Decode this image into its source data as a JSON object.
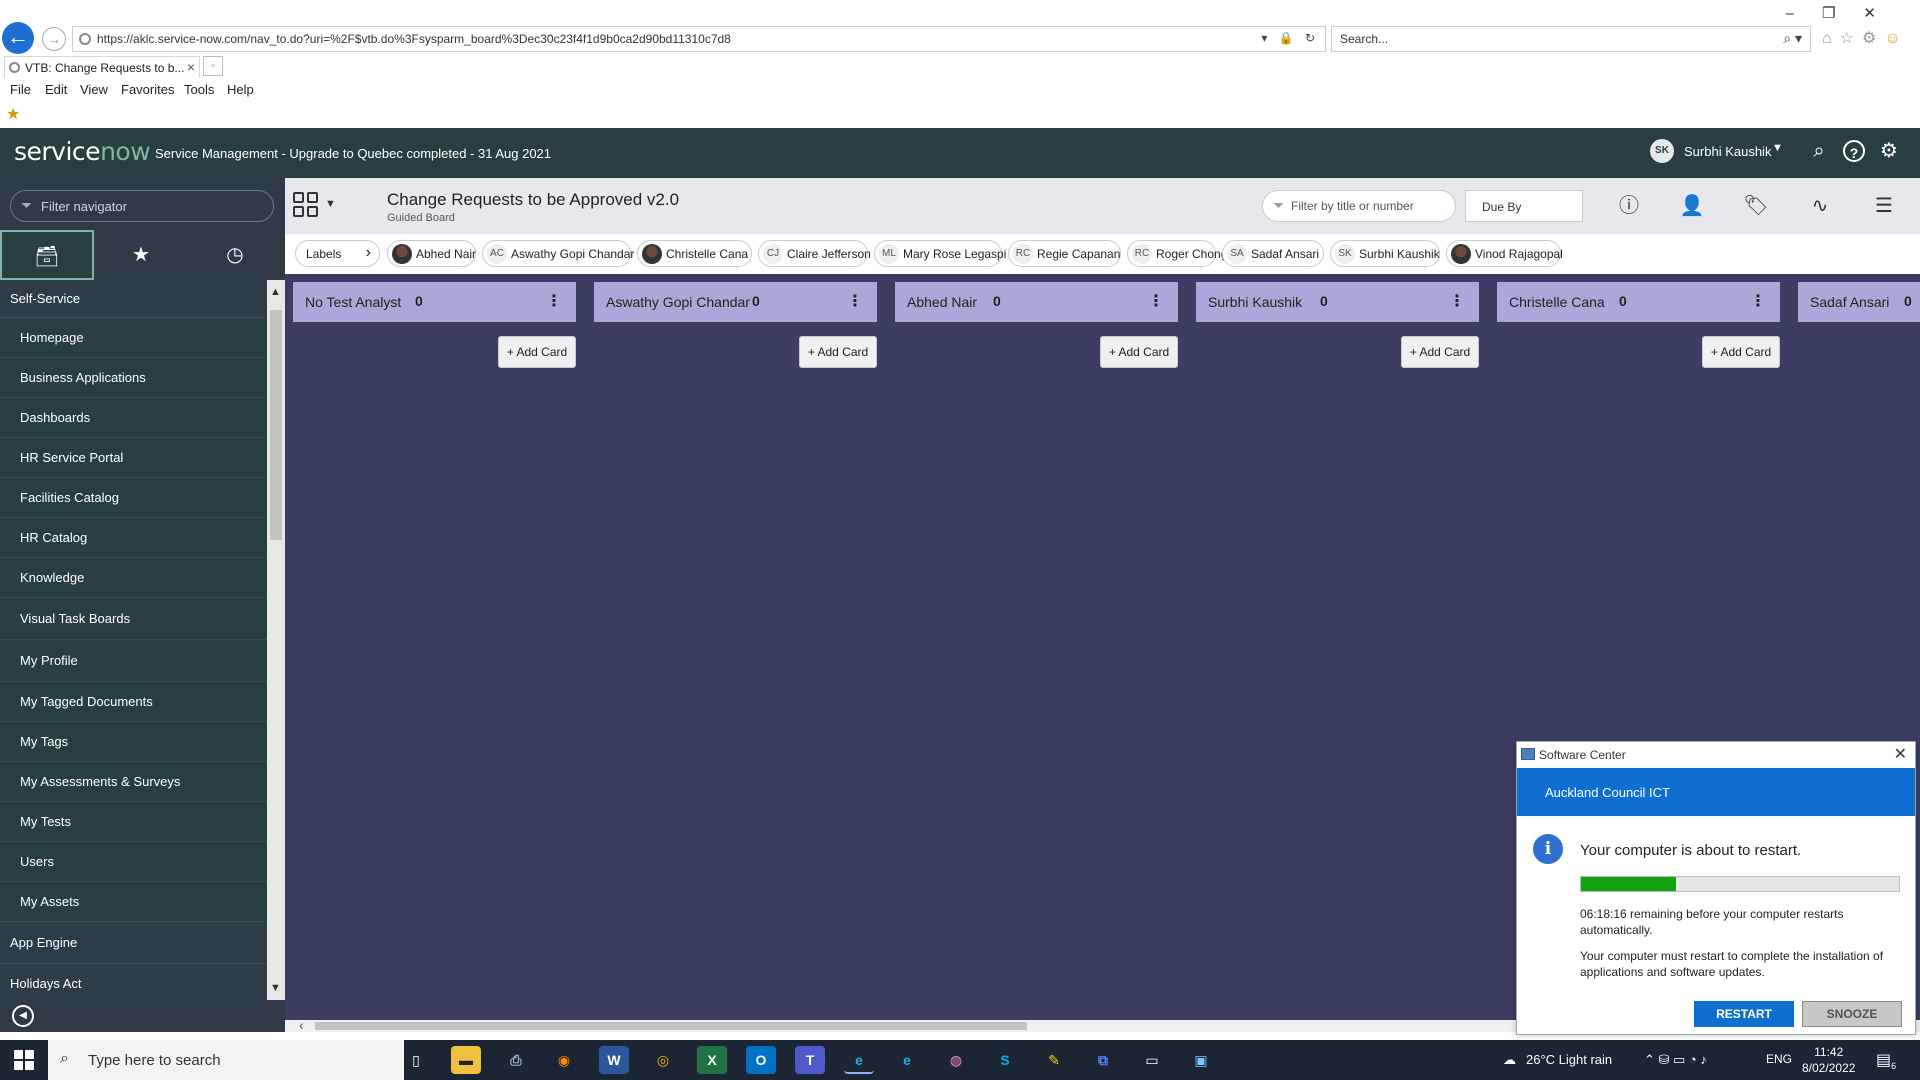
{
  "browser": {
    "url": "https://aklc.service-now.com/nav_to.do?uri=%2F$vtb.do%3Fsysparm_board%3Dec30c23f4f1d9b0ca2d90bd11310c7d8",
    "search_placeholder": "Search...",
    "tab_title": "VTB: Change Requests to b...",
    "menu": [
      "File",
      "Edit",
      "View",
      "Favorites",
      "Tools",
      "Help"
    ]
  },
  "header": {
    "logo_prefix": "service",
    "logo_accent": "now",
    "title": "Service Management - Upgrade to Quebec completed - 31 Aug 2021",
    "user_initials": "SK",
    "user_name": "Surbhi Kaushik"
  },
  "navigator": {
    "filter_placeholder": "Filter navigator",
    "tabs": [
      "all-apps-icon",
      "star-icon",
      "history-icon"
    ],
    "items": [
      {
        "label": "Self-Service",
        "kind": "app"
      },
      {
        "label": "Homepage",
        "kind": "module"
      },
      {
        "label": "Business Applications",
        "kind": "module"
      },
      {
        "label": "Dashboards",
        "kind": "module"
      },
      {
        "label": "HR Service Portal",
        "kind": "module"
      },
      {
        "label": "Facilities Catalog",
        "kind": "module"
      },
      {
        "label": "HR Catalog",
        "kind": "module"
      },
      {
        "label": "Knowledge",
        "kind": "module"
      },
      {
        "label": "Visual Task Boards",
        "kind": "module"
      },
      {
        "label": "My Profile",
        "kind": "module"
      },
      {
        "label": "My Tagged Documents",
        "kind": "module"
      },
      {
        "label": "My Tags",
        "kind": "module"
      },
      {
        "label": "My Assessments & Surveys",
        "kind": "module"
      },
      {
        "label": "My Tests",
        "kind": "module"
      },
      {
        "label": "Users",
        "kind": "module"
      },
      {
        "label": "My Assets",
        "kind": "module"
      },
      {
        "label": "App Engine",
        "kind": "app"
      },
      {
        "label": "Holidays Act",
        "kind": "app"
      }
    ]
  },
  "board": {
    "title": "Change Requests to be Approved v2.0",
    "subtitle": "Guided Board",
    "filter_placeholder": "Filter by title or number",
    "sort": "Due By",
    "labels_chip": "Labels",
    "members": [
      {
        "initials": "",
        "name": "Abhed Nair",
        "photo": true
      },
      {
        "initials": "AC",
        "name": "Aswathy Gopi Chandar",
        "photo": false
      },
      {
        "initials": "",
        "name": "Christelle Cana",
        "photo": true
      },
      {
        "initials": "CJ",
        "name": "Claire Jefferson",
        "photo": false
      },
      {
        "initials": "ML",
        "name": "Mary Rose Legaspi",
        "photo": false
      },
      {
        "initials": "RC",
        "name": "Regie Capanan",
        "photo": false
      },
      {
        "initials": "RC",
        "name": "Roger Chong",
        "photo": false
      },
      {
        "initials": "SA",
        "name": "Sadaf Ansari",
        "photo": false
      },
      {
        "initials": "SK",
        "name": "Surbhi Kaushik",
        "photo": false
      },
      {
        "initials": "",
        "name": "Vinod Rajagopal",
        "photo": true
      }
    ],
    "add_card_label": "+ Add Card",
    "lanes": [
      {
        "title": "No Test Analyst",
        "count": "0"
      },
      {
        "title": "Aswathy Gopi Chandar",
        "count": "0"
      },
      {
        "title": "Abhed Nair",
        "count": "0"
      },
      {
        "title": "Surbhi Kaushik",
        "count": "0"
      },
      {
        "title": "Christelle Cana",
        "count": "0"
      },
      {
        "title": "Sadaf Ansari",
        "count": "0"
      }
    ]
  },
  "popup": {
    "window_title": "Software Center",
    "org": "Auckland Council ICT",
    "message": "Your computer is about to restart.",
    "progress": 0.3,
    "remaining": "06:18:16 remaining before your computer restarts automatically.",
    "detail": "Your computer must restart to complete the installation of applications and software updates.",
    "restart_label": "RESTART",
    "snooze_label": "SNOOZE"
  },
  "taskbar": {
    "search_placeholder": "Type here to search",
    "weather": "26°C  Light rain",
    "language": "ENG",
    "time": "11:42",
    "date": "8/02/2022",
    "notification_count": "6"
  },
  "colors": {
    "header": "#293e40",
    "board_bg": "#3b3d63",
    "lane_header": "#a9a8d8",
    "accent": "#81b5a1",
    "popup_blue": "#0f6fd0"
  }
}
